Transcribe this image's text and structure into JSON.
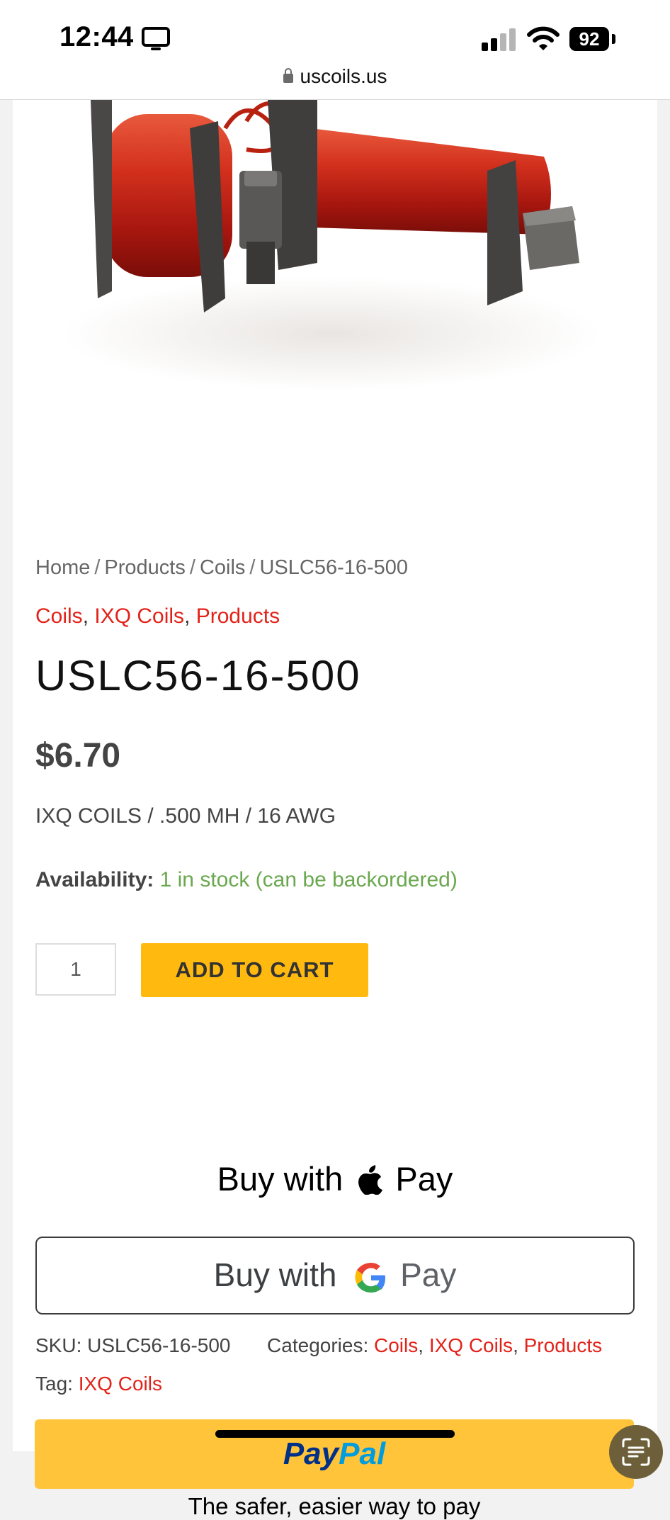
{
  "status_bar": {
    "time": "12:44",
    "battery": "92",
    "url": "uscoils.us"
  },
  "breadcrumb": {
    "items": [
      "Home",
      "Products",
      "Coils",
      "USLC56-16-500"
    ],
    "separator": "/"
  },
  "categories_top": [
    "Coils",
    "IXQ Coils",
    "Products"
  ],
  "product": {
    "title": "USLC56-16-500",
    "price": "$6.70",
    "specs": "IXQ COILS / .500 MH / 16 AWG",
    "availability_label": "Availability:",
    "availability_value": "1 in stock (can be backordered)",
    "quantity": "1",
    "add_to_cart_label": "ADD TO CART"
  },
  "payments": {
    "apple_pay_prefix": "Buy with",
    "apple_pay_word": "Pay",
    "google_pay_prefix": "Buy with",
    "google_pay_word": "Pay",
    "paypal_part1": "Pay",
    "paypal_part2": "Pal",
    "paypal_tagline": "The safer, easier way to pay"
  },
  "meta": {
    "sku_label": "SKU:",
    "sku_value": "USLC56-16-500",
    "categories_label": "Categories:",
    "categories": [
      "Coils",
      "IXQ Coils",
      "Products"
    ],
    "tag_label": "Tag:",
    "tag_value": "IXQ Coils"
  },
  "colors": {
    "link_red": "#e2231a",
    "stock_green": "#6aa84f",
    "cart_yellow": "#ffb90f",
    "paypal_yellow": "#ffc439"
  }
}
